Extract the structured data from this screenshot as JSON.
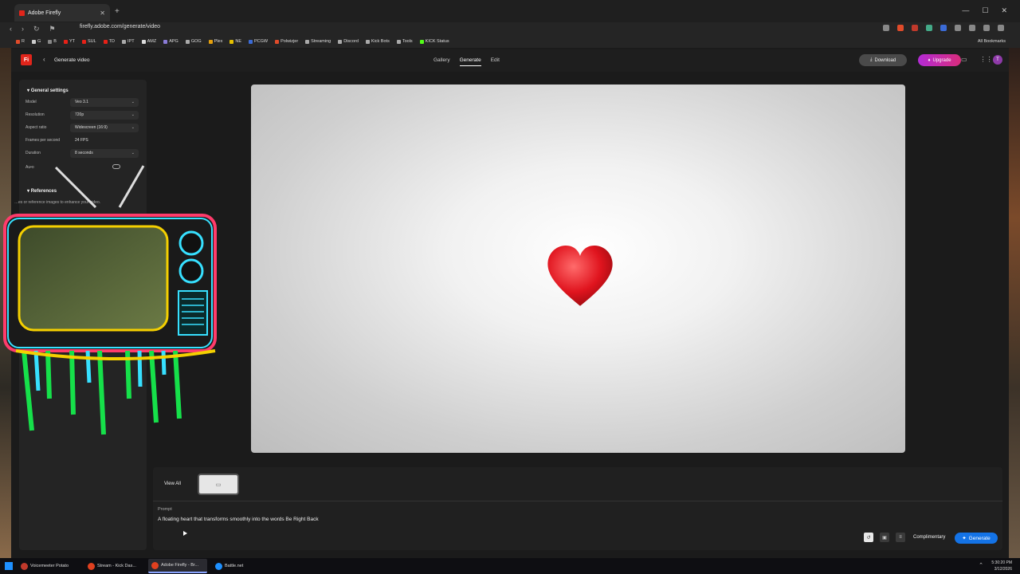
{
  "browser": {
    "tab_title": "Adobe Firefly",
    "url": "firefly.adobe.com/generate/video",
    "bookmarks": [
      {
        "label": "R",
        "color": "#e04b2a"
      },
      {
        "label": "G",
        "color": "#ccc"
      },
      {
        "label": "B",
        "color": "#888"
      },
      {
        "label": "YT",
        "color": "#e62117"
      },
      {
        "label": "SUL",
        "color": "#e62117"
      },
      {
        "label": "TD",
        "color": "#e62117"
      },
      {
        "label": "IPT",
        "color": "#aaa"
      },
      {
        "label": "AMZ",
        "color": "#ddd"
      },
      {
        "label": "APG",
        "color": "#8a7bd6"
      },
      {
        "label": "GOG",
        "color": "#aaa"
      },
      {
        "label": "Plex",
        "color": "#e5a00d"
      },
      {
        "label": "NE",
        "color": "#e5c000"
      },
      {
        "label": "PCGW",
        "color": "#3b6bd6"
      },
      {
        "label": "Polwizjer",
        "color": "#e04b2a"
      },
      {
        "label": "Streaming",
        "color": "#aaa"
      },
      {
        "label": "Discord",
        "color": "#aaa"
      },
      {
        "label": "Kick Bots",
        "color": "#aaa"
      },
      {
        "label": "Tools",
        "color": "#aaa"
      },
      {
        "label": "KICK Status",
        "color": "#53fc18"
      }
    ],
    "all_bookmarks": "All Bookmarks"
  },
  "header": {
    "logo": "Fi",
    "title": "Generate video",
    "tabs": [
      "Gallery",
      "Generate",
      "Edit"
    ],
    "download": "Download",
    "upgrade": "Upgrade",
    "avatar": "T"
  },
  "settings": {
    "section": "General settings",
    "model_label": "Model",
    "model_value": "Veo 3.1",
    "resolution_label": "Resolution",
    "resolution_value": "720p",
    "aspect_label": "Aspect ratio",
    "aspect_value": "Widescreen (16:9)",
    "fps_label": "Frames per second",
    "fps_value": "24 FPS",
    "duration_label": "Duration",
    "duration_value": "8 seconds",
    "audio_label": "Au•o",
    "references": "References",
    "references_desc": "…es or reference images to enhance your video."
  },
  "bottom": {
    "view_all": "View All",
    "prompt_label": "Prompt",
    "prompt_text": "A floating heart that transforms smoothly into the words Be Right Back",
    "complimentary": "Complimentary",
    "generate": "Generate"
  },
  "taskbar": {
    "items": [
      {
        "label": "Voicemeeter Potato",
        "color": "#c0392b"
      },
      {
        "label": "Stream - Kick Das...",
        "color": "#e0401f"
      },
      {
        "label": "Adobe Firefly - Br...",
        "color": "#e0401f"
      },
      {
        "label": "Battle.net",
        "color": "#1e90ff"
      }
    ],
    "time": "5:30:20 PM",
    "date": "3/12/2026"
  },
  "colors": {
    "accent": "#1473e6",
    "brand": "#e1251b"
  }
}
